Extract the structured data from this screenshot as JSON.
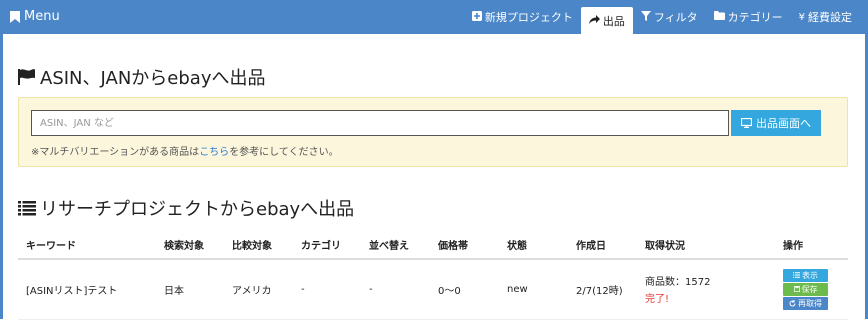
{
  "navbar": {
    "brand": "Menu",
    "items": [
      {
        "label": "新規プロジェクト",
        "icon": "plus-square-icon"
      },
      {
        "label": "出品",
        "icon": "share-arrow-icon",
        "active": true
      },
      {
        "label": "フィルタ",
        "icon": "filter-icon"
      },
      {
        "label": "カテゴリー",
        "icon": "folder-icon"
      },
      {
        "label": "経費設定",
        "icon": "yen-icon"
      }
    ]
  },
  "asin_section": {
    "title": "ASIN、JANからebayへ出品",
    "input_placeholder": "ASIN、JAN など",
    "input_value": "",
    "button_label": "出品画面へ",
    "note_prefix": "※マルチバリエーションがある商品は",
    "note_link": "こちら",
    "note_suffix": "を参考にしてください。"
  },
  "research_section": {
    "title": "リサーチプロジェクトからebayへ出品",
    "columns": [
      "キーワード",
      "検索対象",
      "比較対象",
      "カテゴリ",
      "並べ替え",
      "価格帯",
      "状態",
      "作成日",
      "取得状況",
      "操作"
    ],
    "rows": [
      {
        "keyword": "[ASINリスト]テスト",
        "search_target": "日本",
        "compare_target": "アメリカ",
        "category": "-",
        "sort": "-",
        "price_range": "0〜0",
        "condition": "new",
        "created": "2/7(12時)",
        "status_count": "商品数：1572",
        "status_done": "完了!",
        "ops": {
          "show": "表示",
          "save": "保存",
          "refetch": "再取得"
        }
      }
    ]
  },
  "colors": {
    "navbar": "#4a86c8",
    "accent_button": "#33a7de",
    "save_button": "#6cbb4c",
    "done_text": "#e53935",
    "well_bg": "#fcf6dd"
  }
}
